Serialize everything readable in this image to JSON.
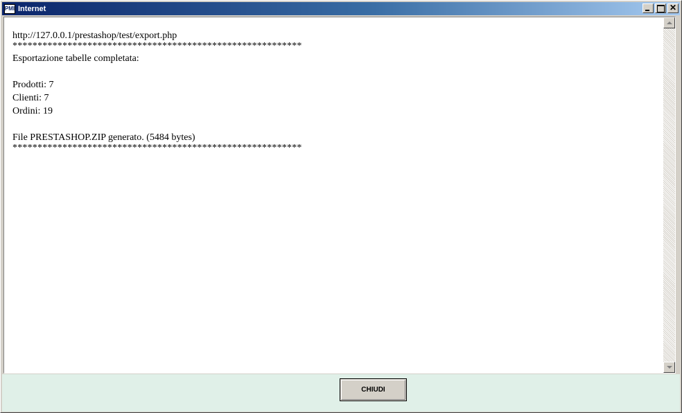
{
  "window": {
    "title": "Internet",
    "icon_label": "PMI",
    "controls": {
      "minimize": "minimize",
      "maximize": "maximize",
      "close": "✕"
    }
  },
  "content": {
    "lines": [
      "http://127.0.0.1/prestashop/test/export.php",
      "**********************************************************",
      "Esportazione tabelle completata:",
      "",
      "Prodotti: 7",
      "Clienti: 7",
      "Ordini: 19",
      "",
      "File PRESTASHOP.ZIP generato. (5484 bytes)",
      "**********************************************************"
    ]
  },
  "footer": {
    "close_label": "CHIUDI"
  },
  "colors": {
    "titlebar_start": "#0a246a",
    "titlebar_end": "#a6caf0",
    "footer_bg": "#e0f0e8"
  }
}
